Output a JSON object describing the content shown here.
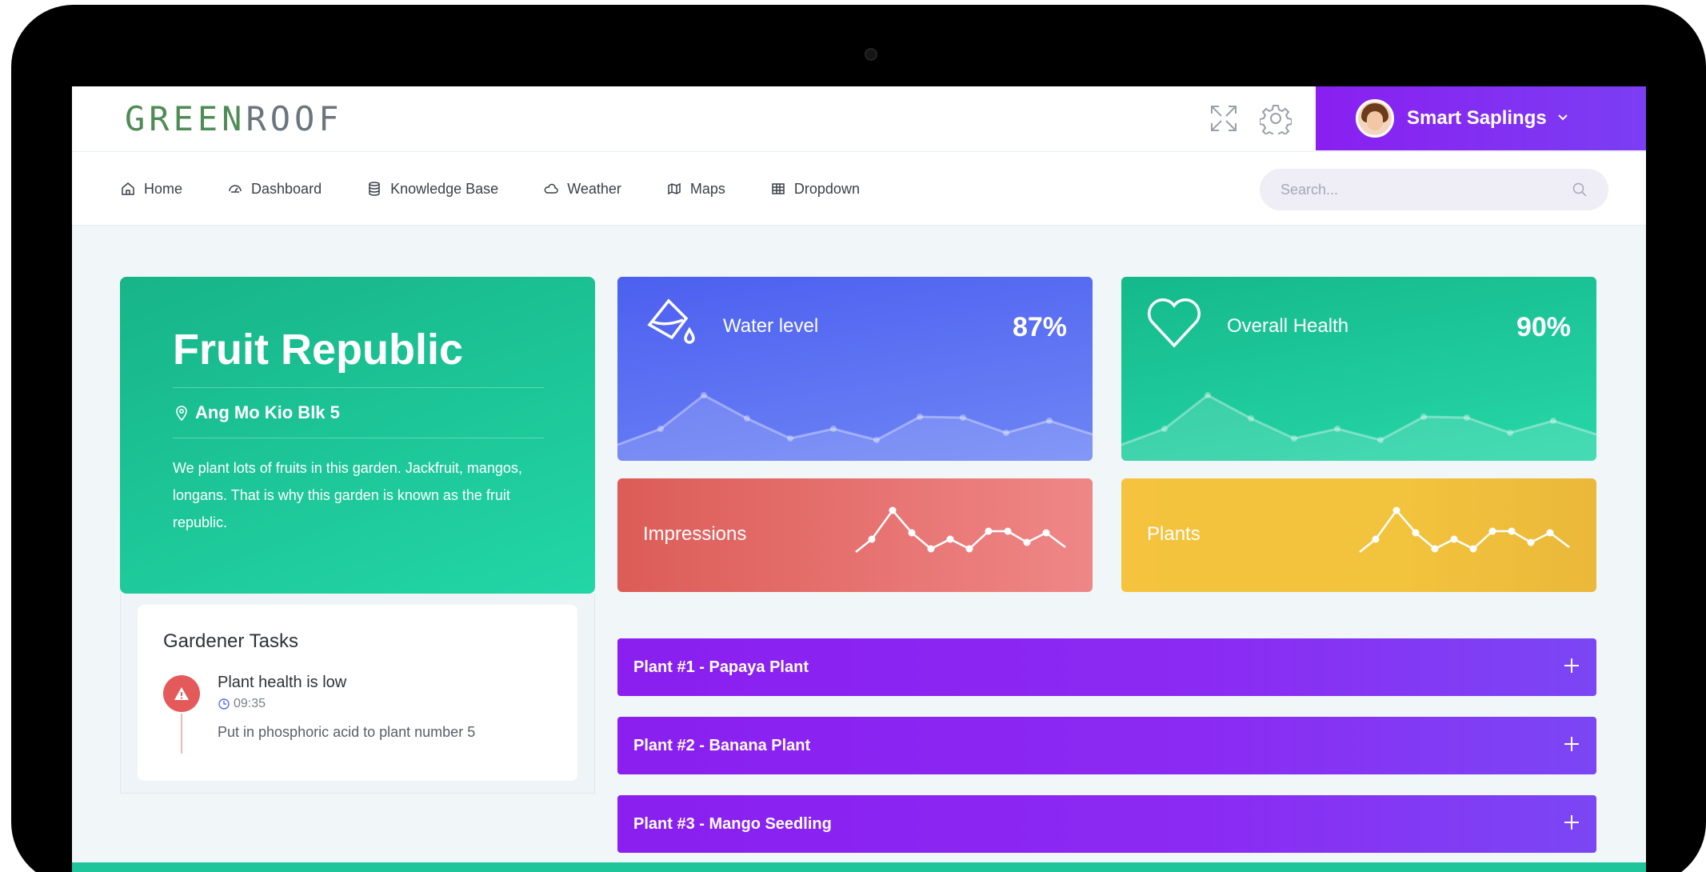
{
  "brand": {
    "part1": "GREEN",
    "part2": "ROOF"
  },
  "user": {
    "name": "Smart Saplings"
  },
  "nav": {
    "items": [
      {
        "label": "Home",
        "icon": "home-icon"
      },
      {
        "label": "Dashboard",
        "icon": "dashboard-icon"
      },
      {
        "label": "Knowledge Base",
        "icon": "database-icon"
      },
      {
        "label": "Weather",
        "icon": "cloud-icon"
      },
      {
        "label": "Maps",
        "icon": "map-icon"
      },
      {
        "label": "Dropdown",
        "icon": "table-icon"
      }
    ]
  },
  "search": {
    "placeholder": "Search..."
  },
  "profile": {
    "title": "Fruit Republic",
    "location": "Ang Mo Kio Blk 5",
    "description": "We plant lots of fruits in this garden. Jackfruit, mangos, longans. That is why this garden is known as the fruit republic."
  },
  "tasks": {
    "heading": "Gardener Tasks",
    "items": [
      {
        "title": "Plant health is low",
        "time": "09:35",
        "note": "Put in phosphoric acid to plant number 5"
      }
    ]
  },
  "stats": {
    "water": {
      "label": "Water level",
      "value": "87%"
    },
    "health": {
      "label": "Overall Health",
      "value": "90%"
    },
    "impressions": {
      "label": "Impressions"
    },
    "plants": {
      "label": "Plants"
    }
  },
  "accordion": [
    {
      "title": "Plant #1 - Papaya Plant"
    },
    {
      "title": "Plant #2 - Banana Plant"
    },
    {
      "title": "Plant #3 - Mango Seedling"
    }
  ],
  "colors": {
    "brand_green": "#4f8c55",
    "accent_purple": "#8a1ff0",
    "teal": "#1ec59a",
    "blue": "#4c5ff0",
    "red": "#dc5c57",
    "yellow": "#f5c33d"
  }
}
